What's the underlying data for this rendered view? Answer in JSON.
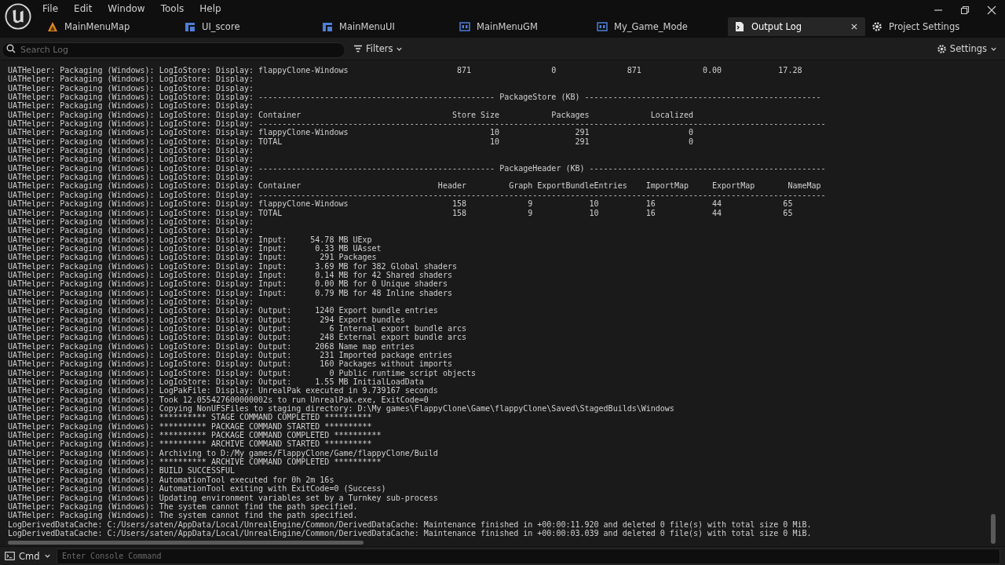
{
  "menu": [
    "File",
    "Edit",
    "Window",
    "Tools",
    "Help"
  ],
  "tabs": [
    {
      "label": "MainMenuMap",
      "kind": "level",
      "selected": false
    },
    {
      "label": "UI_score",
      "kind": "widget",
      "selected": false
    },
    {
      "label": "MainMenuUI",
      "kind": "widget",
      "selected": false
    },
    {
      "label": "MainMenuGM",
      "kind": "blueprint",
      "selected": false
    },
    {
      "label": "My_Game_Mode",
      "kind": "blueprint",
      "selected": false
    },
    {
      "label": "Output Log",
      "kind": "log",
      "selected": true
    },
    {
      "label": "Project Settings",
      "kind": "settings",
      "selected": false
    }
  ],
  "toolbar": {
    "search": {
      "placeholder": "Search Log"
    },
    "filters": "Filters",
    "settings": "Settings"
  },
  "log_lines": [
    "UATHelper: Packaging (Windows): LogIoStore: Display: flappyClone-Windows                       871                 0               871             0.00            17.28",
    "UATHelper: Packaging (Windows): LogIoStore: Display:",
    "UATHelper: Packaging (Windows): LogIoStore: Display:",
    "UATHelper: Packaging (Windows): LogIoStore: Display: -------------------------------------------------- PackageStore (KB) --------------------------------------------------",
    "UATHelper: Packaging (Windows): LogIoStore: Display:",
    "UATHelper: Packaging (Windows): LogIoStore: Display: Container                                Store Size           Packages             Localized",
    "UATHelper: Packaging (Windows): LogIoStore: Display: ------------------------------------------------------------------------------------------------------------------------",
    "UATHelper: Packaging (Windows): LogIoStore: Display: flappyClone-Windows                              10                291                     0",
    "UATHelper: Packaging (Windows): LogIoStore: Display: TOTAL                                            10                291                     0",
    "UATHelper: Packaging (Windows): LogIoStore: Display:",
    "UATHelper: Packaging (Windows): LogIoStore: Display:",
    "UATHelper: Packaging (Windows): LogIoStore: Display: -------------------------------------------------- PackageHeader (KB) --------------------------------------------------",
    "UATHelper: Packaging (Windows): LogIoStore: Display:",
    "UATHelper: Packaging (Windows): LogIoStore: Display: Container                             Header         Graph ExportBundleEntries    ImportMap     ExportMap       NameMap",
    "UATHelper: Packaging (Windows): LogIoStore: Display: ------------------------------------------------------------------------------------------------------------------------",
    "UATHelper: Packaging (Windows): LogIoStore: Display: flappyClone-Windows                      158             9            10          16            44             65",
    "UATHelper: Packaging (Windows): LogIoStore: Display: TOTAL                                    158             9            10          16            44             65",
    "UATHelper: Packaging (Windows): LogIoStore: Display:",
    "UATHelper: Packaging (Windows): LogIoStore: Display:",
    "UATHelper: Packaging (Windows): LogIoStore: Display: Input:     54.78 MB UExp",
    "UATHelper: Packaging (Windows): LogIoStore: Display: Input:      0.33 MB UAsset",
    "UATHelper: Packaging (Windows): LogIoStore: Display: Input:       291 Packages",
    "UATHelper: Packaging (Windows): LogIoStore: Display: Input:      3.69 MB for 382 Global shaders",
    "UATHelper: Packaging (Windows): LogIoStore: Display: Input:      0.14 MB for 42 Shared shaders",
    "UATHelper: Packaging (Windows): LogIoStore: Display: Input:      0.00 MB for 0 Unique shaders",
    "UATHelper: Packaging (Windows): LogIoStore: Display: Input:      0.79 MB for 48 Inline shaders",
    "UATHelper: Packaging (Windows): LogIoStore: Display:",
    "UATHelper: Packaging (Windows): LogIoStore: Display: Output:     1240 Export bundle entries",
    "UATHelper: Packaging (Windows): LogIoStore: Display: Output:      294 Export bundles",
    "UATHelper: Packaging (Windows): LogIoStore: Display: Output:        6 Internal export bundle arcs",
    "UATHelper: Packaging (Windows): LogIoStore: Display: Output:      248 External export bundle arcs",
    "UATHelper: Packaging (Windows): LogIoStore: Display: Output:     2068 Name map entries",
    "UATHelper: Packaging (Windows): LogIoStore: Display: Output:      231 Imported package entries",
    "UATHelper: Packaging (Windows): LogIoStore: Display: Output:      160 Packages without imports",
    "UATHelper: Packaging (Windows): LogIoStore: Display: Output:        0 Public runtime script objects",
    "UATHelper: Packaging (Windows): LogIoStore: Display: Output:     1.55 MB InitialLoadData",
    "UATHelper: Packaging (Windows): LogPakFile: Display: UnrealPak executed in 9.739167 seconds",
    "UATHelper: Packaging (Windows): Took 12.055427600000002s to run UnrealPak.exe, ExitCode=0",
    "UATHelper: Packaging (Windows): Copying NonUFSFiles to staging directory: D:\\My games\\FlappyClone\\Game\\flappyClone\\Saved\\StagedBuilds\\Windows",
    "UATHelper: Packaging (Windows): ********** STAGE COMMAND COMPLETED **********",
    "UATHelper: Packaging (Windows): ********** PACKAGE COMMAND STARTED **********",
    "UATHelper: Packaging (Windows): ********** PACKAGE COMMAND COMPLETED **********",
    "UATHelper: Packaging (Windows): ********** ARCHIVE COMMAND STARTED **********",
    "UATHelper: Packaging (Windows): Archiving to D:/My games/FlappyClone/Game/flappyClone/Build",
    "UATHelper: Packaging (Windows): ********** ARCHIVE COMMAND COMPLETED **********",
    "UATHelper: Packaging (Windows): BUILD SUCCESSFUL",
    "UATHelper: Packaging (Windows): AutomationTool executed for 0h 2m 16s",
    "UATHelper: Packaging (Windows): AutomationTool exiting with ExitCode=0 (Success)",
    "UATHelper: Packaging (Windows): Updating environment variables set by a Turnkey sub-process",
    "UATHelper: Packaging (Windows): The system cannot find the path specified.",
    "UATHelper: Packaging (Windows): The system cannot find the path specified.",
    "LogDerivedDataCache: C:/Users/saten/AppData/Local/UnrealEngine/Common/DerivedDataCache: Maintenance finished in +00:00:11.920 and deleted 0 file(s) with total size 0 MiB.",
    "LogDerivedDataCache: C:/Users/saten/AppData/Local/UnrealEngine/Common/DerivedDataCache: Maintenance finished in +00:00:03.039 and deleted 0 file(s) with total size 0 MiB."
  ],
  "console": {
    "mode": "Cmd",
    "placeholder": "Enter Console Command"
  }
}
